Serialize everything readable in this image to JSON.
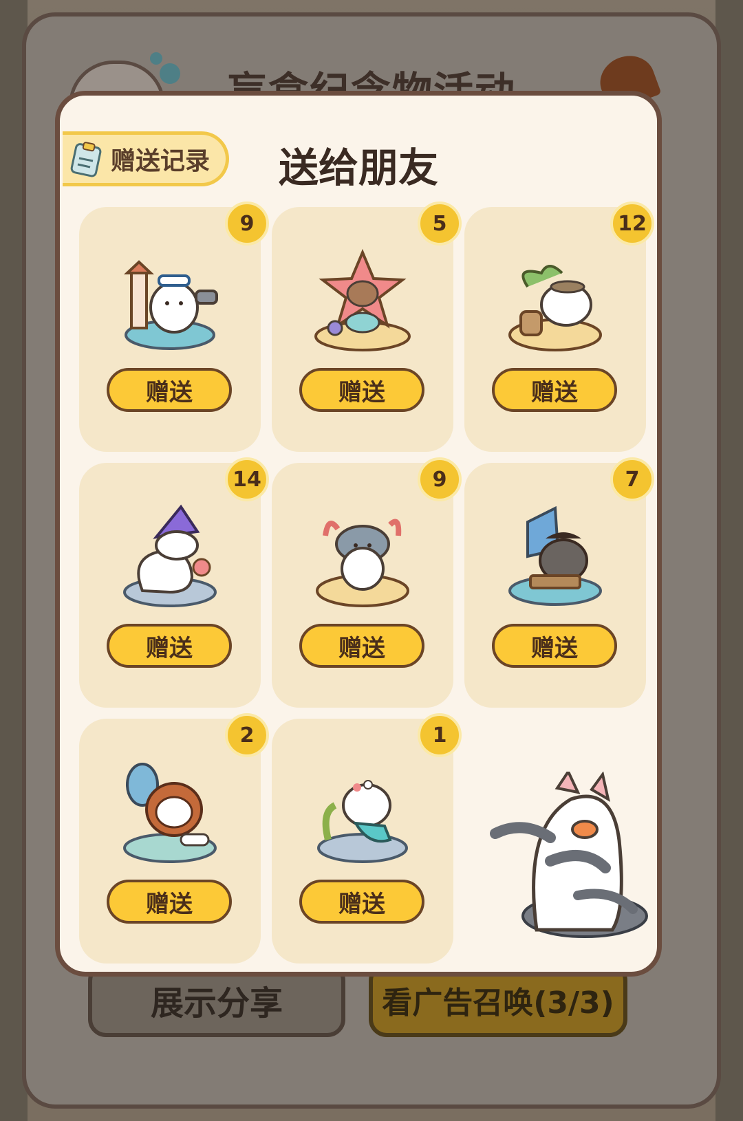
{
  "outer_panel": {
    "title": "盲盒纪念物活动",
    "share_button": "展示分享",
    "ad_button": "看广告召唤(3/3)"
  },
  "modal": {
    "title": "送给朋友",
    "record_button": "赠送记录",
    "items": [
      {
        "count": "9",
        "button": "赠送",
        "icon": "sailor-cat-lighthouse-icon"
      },
      {
        "count": "5",
        "button": "赠送",
        "icon": "starfish-cat-icon"
      },
      {
        "count": "12",
        "button": "赠送",
        "icon": "island-palm-cat-icon"
      },
      {
        "count": "14",
        "button": "赠送",
        "icon": "wizard-cat-shell-icon"
      },
      {
        "count": "9",
        "button": "赠送",
        "icon": "shark-hat-cat-icon"
      },
      {
        "count": "7",
        "button": "赠送",
        "icon": "pirate-raccoon-icon"
      },
      {
        "count": "2",
        "button": "赠送",
        "icon": "crab-costume-cat-icon"
      },
      {
        "count": "1",
        "button": "赠送",
        "icon": "mermaid-cat-icon"
      }
    ]
  },
  "colors": {
    "modal_bg": "#fbf4ea",
    "card_bg": "#f5e7c9",
    "gift_button": "#fcc937",
    "badge": "#f4c430",
    "outline": "#6b4526"
  }
}
